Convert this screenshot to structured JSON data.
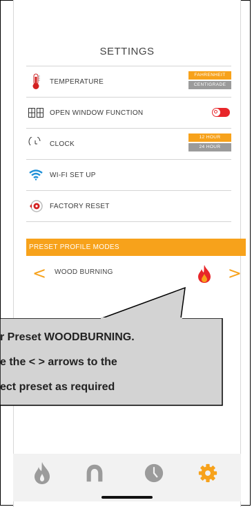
{
  "screen": {
    "title": "SETTINGS"
  },
  "settings": {
    "temperature": {
      "label": "TEMPERATURE",
      "options": [
        "FAHRENHEIT",
        "CENTIGRADE"
      ],
      "selected": "FAHRENHEIT"
    },
    "open_window": {
      "label": "OPEN WINDOW FUNCTION",
      "toggle_on": true
    },
    "clock": {
      "label": "CLOCK",
      "icon_text": "12/24",
      "options": [
        "12 HOUR",
        "24 HOUR"
      ],
      "selected": "12 HOUR"
    },
    "wifi": {
      "label": "WI-FI SET UP"
    },
    "factory_reset": {
      "label": "FACTORY RESET"
    }
  },
  "preset": {
    "header": "PRESET PROFILE MODES",
    "current": "WOOD BURNING",
    "prev_arrow": "<",
    "next_arrow": ">"
  },
  "callout": {
    "lines": [
      "r Preset WOODBURNING.",
      "e the < > arrows to the",
      "ect preset as required"
    ]
  },
  "tabs": [
    {
      "icon": "flame-icon",
      "active": false
    },
    {
      "icon": "profile-icon",
      "active": false
    },
    {
      "icon": "clock-icon",
      "active": false
    },
    {
      "icon": "gear-icon",
      "active": true
    }
  ],
  "colors": {
    "accent": "#f7a21b",
    "inactive_option": "#9b9b9b",
    "toggle": "#e8262a",
    "tab_inactive": "#9b9b9b",
    "flame_red": "#e8262a"
  }
}
